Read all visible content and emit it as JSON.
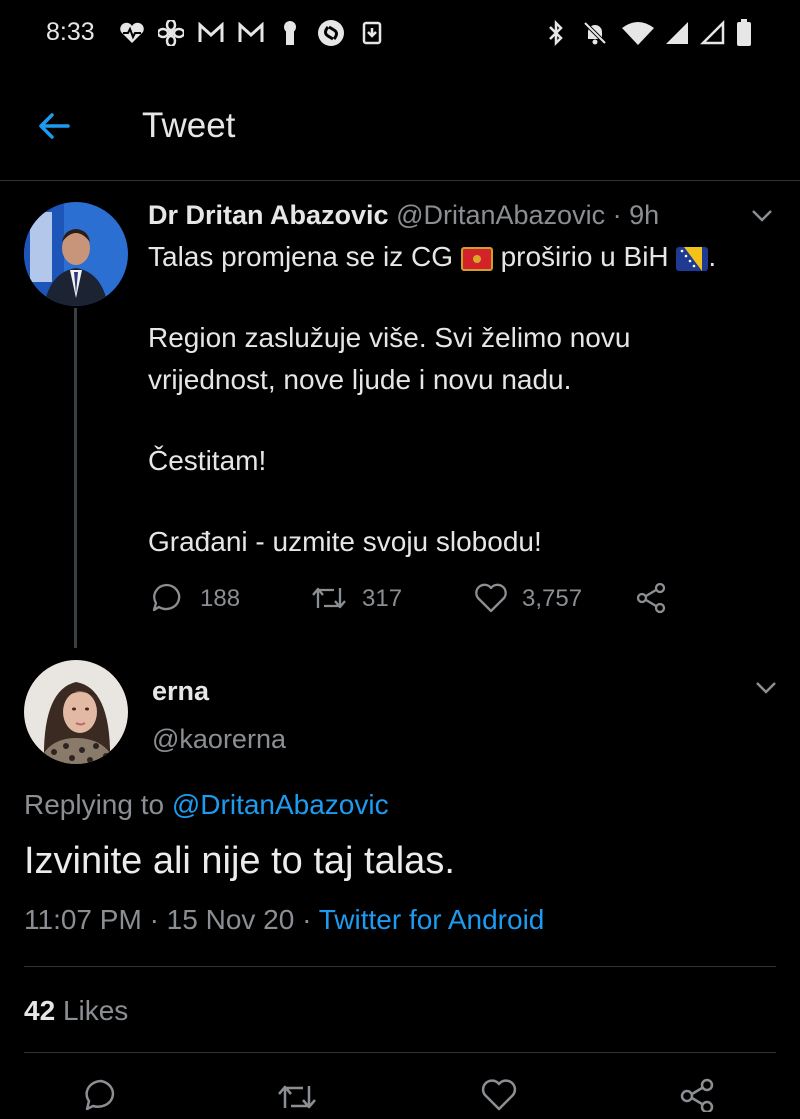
{
  "status_bar": {
    "time": "8:33",
    "left_icons": [
      "heartbeat-icon",
      "fan-icon",
      "mail-m-icon",
      "mail-m-icon",
      "keyhole-icon",
      "shazam-icon",
      "download-icon"
    ],
    "right_icons": [
      "bluetooth-icon",
      "mute-bell-icon",
      "wifi-icon",
      "signal-icon",
      "signal-empty-icon",
      "battery-icon"
    ]
  },
  "header": {
    "title": "Tweet"
  },
  "parent_tweet": {
    "name": "Dr Dritan Abazovic",
    "handle": "@DritanAbazovic",
    "sep": "·",
    "age": "9h",
    "line1_a": "Talas promjena se iz CG",
    "line1_b": "proširio u BiH",
    "line1_c": ".",
    "para2_line1": "Region zaslužuje više. Svi želimo novu",
    "para2_line2": "vrijednost, nove ljude i novu nadu.",
    "para3": "Čestitam!",
    "para4": "Građani - uzmite svoju slobodu!",
    "replies": "188",
    "retweets": "317",
    "likes": "3,757"
  },
  "reply": {
    "name": "erna",
    "handle": "@kaorerna",
    "replying_prefix": "Replying to",
    "replying_to": "@DritanAbazovic",
    "text": "Izvinite ali nije to taj talas.",
    "time": "11:07 PM",
    "dot1": "·",
    "date": "15 Nov 20",
    "dot2": "·",
    "source": "Twitter for Android",
    "likes_count": "42",
    "likes_label": "Likes"
  },
  "colors": {
    "accent": "#1d9bf0",
    "background": "#000000",
    "muted": "#8b8f93"
  }
}
